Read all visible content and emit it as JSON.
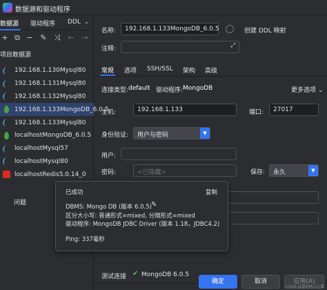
{
  "window": {
    "title": "数据源和驱动程序"
  },
  "left": {
    "tabs": [
      "数据源",
      "驱动程序",
      "DDL"
    ],
    "section_title": "项目数据源",
    "items": [
      {
        "label": "192.168.1.130Mysql80",
        "icon": "mysql-icon",
        "selected": false
      },
      {
        "label": "192.168.1.131Mysql80",
        "icon": "mysql-icon",
        "selected": false
      },
      {
        "label": "192.168.1.132Mysql80",
        "icon": "mysql-icon",
        "selected": false
      },
      {
        "label": "192.168.1.133MongoDB_6.0.5",
        "icon": "mongodb-icon",
        "selected": true
      },
      {
        "label": "192.168.1.133Mysql80",
        "icon": "mysql-icon",
        "selected": false
      },
      {
        "label": "localhostMongoDB_6.0.5",
        "icon": "mongodb-icon",
        "selected": false
      },
      {
        "label": "localhostMysql57",
        "icon": "mysql-icon",
        "selected": false
      },
      {
        "label": "localhostMysql80",
        "icon": "mysql-icon",
        "selected": false
      },
      {
        "label": "localhostRedis5.0.14_0",
        "icon": "redis-icon",
        "selected": false
      }
    ],
    "problems_label": "问题"
  },
  "form": {
    "name_label": "名称:",
    "name_value": "192.168.1.133MongoDB_6.0.5",
    "create_ddl_label": "创建 DDL 映射",
    "comment_label": "注释:",
    "tabs": [
      "常规",
      "选项",
      "SSH/SSL",
      "架构",
      "高级"
    ],
    "conn_type_label": "连接类型:",
    "conn_type_value": "default",
    "driver_label": "驱动程序:",
    "driver_value": "MongoDB",
    "more_options": "更多选项",
    "host_label": "主机:",
    "host_value": "192.168.1.133",
    "port_label": "端口:",
    "port_value": "27017",
    "auth_label": "身份验证:",
    "auth_value": "用户与密码",
    "user_label": "用户:",
    "password_label": "密码:",
    "password_placeholder": "<已隐藏>",
    "save_label": "保存:",
    "save_value": "永久"
  },
  "popup": {
    "status": "已成功",
    "copy": "复制",
    "line1": "DBMS: Mongo DB (版本 6.0.5)",
    "line2": "区分大小写: 普通形式=mixed, 分隔形式=mixed",
    "line3": "驱动程序: MongoDB JDBC Driver (版本 1.18，JDBC4.2)",
    "line4": "Ping: 337毫秒"
  },
  "footer": {
    "test_connection": "测试连接",
    "test_result": "MongoDB 6.0.5",
    "ok": "确定",
    "cancel": "取消",
    "apply": "应用(A)",
    "watermark": "CSDN @曾经的三心草"
  },
  "colors": {
    "accent": "#3574f0",
    "success": "#5fb865",
    "selection": "#2e436e"
  }
}
